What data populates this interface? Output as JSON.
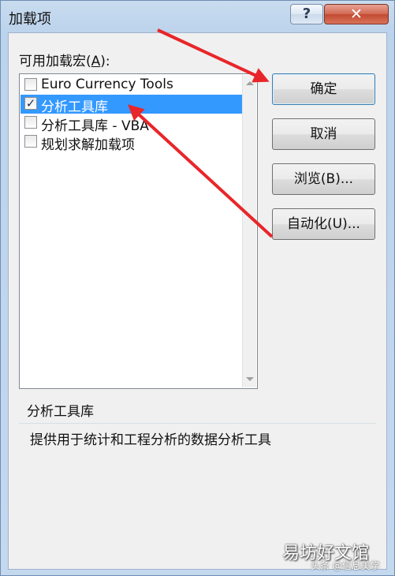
{
  "window": {
    "title": "加载项",
    "help_label": "?",
    "close_label": "✕"
  },
  "list": {
    "label_prefix": "可用加载宏(",
    "label_accel": "A",
    "label_suffix": "):",
    "items": [
      {
        "label": "Euro Currency Tools",
        "checked": false,
        "selected": false
      },
      {
        "label": "分析工具库",
        "checked": true,
        "selected": true
      },
      {
        "label": "分析工具库 - VBA",
        "checked": false,
        "selected": false
      },
      {
        "label": "规划求解加载项",
        "checked": false,
        "selected": false
      }
    ]
  },
  "buttons": {
    "ok": "确定",
    "cancel": "取消",
    "browse": "浏览(B)...",
    "automation": "自动化(U)..."
  },
  "description": {
    "title": "分析工具库",
    "text": "提供用于统计和工程分析的数据分析工具"
  },
  "watermark": {
    "site": "易坊好文馆",
    "handle": "头条 @信息美学"
  },
  "colors": {
    "selection": "#3399ff",
    "annotation_arrow": "#e8262a"
  }
}
